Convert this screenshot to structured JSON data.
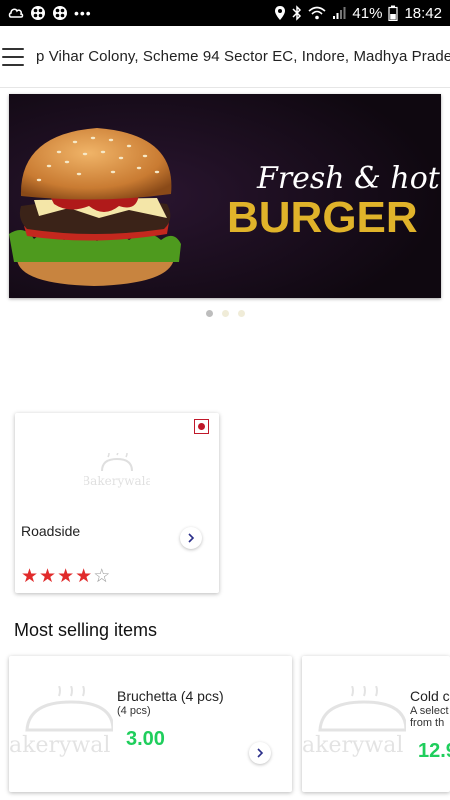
{
  "status_bar": {
    "dots": "•••",
    "battery_percent": "41%",
    "time": "18:42",
    "icons": [
      "notification-icon",
      "app-icon",
      "app-icon-2",
      "location-icon",
      "bluetooth-icon",
      "wifi-icon",
      "signal-icon",
      "battery-icon"
    ]
  },
  "header": {
    "address": "p Vihar Colony, Scheme 94 Sector EC, Indore, Madhya Prade"
  },
  "banner": {
    "headline_script": "Fresh & hot",
    "headline_bold": "BURGER",
    "slide_count": 3,
    "active_slide": 0,
    "colors": {
      "background": "#140a16",
      "headline_bold": "#e0b32a",
      "headline_script": "#ffffff"
    }
  },
  "store": {
    "name": "Roadside",
    "rating": 4,
    "max_rating": 5,
    "logo_text": "Bakerywala",
    "veg_mark_color": "#c0182a"
  },
  "most_selling": {
    "title": "Most selling items",
    "items": [
      {
        "name": "Bruchetta (4 pcs)",
        "subtitle": "(4 pcs)",
        "price": "3.00"
      },
      {
        "name": "Cold c",
        "subtitle": "A select",
        "subtitle2": "from th",
        "price": "12.9"
      }
    ],
    "logo_text": "akerywal",
    "price_color": "#1fce5c"
  }
}
